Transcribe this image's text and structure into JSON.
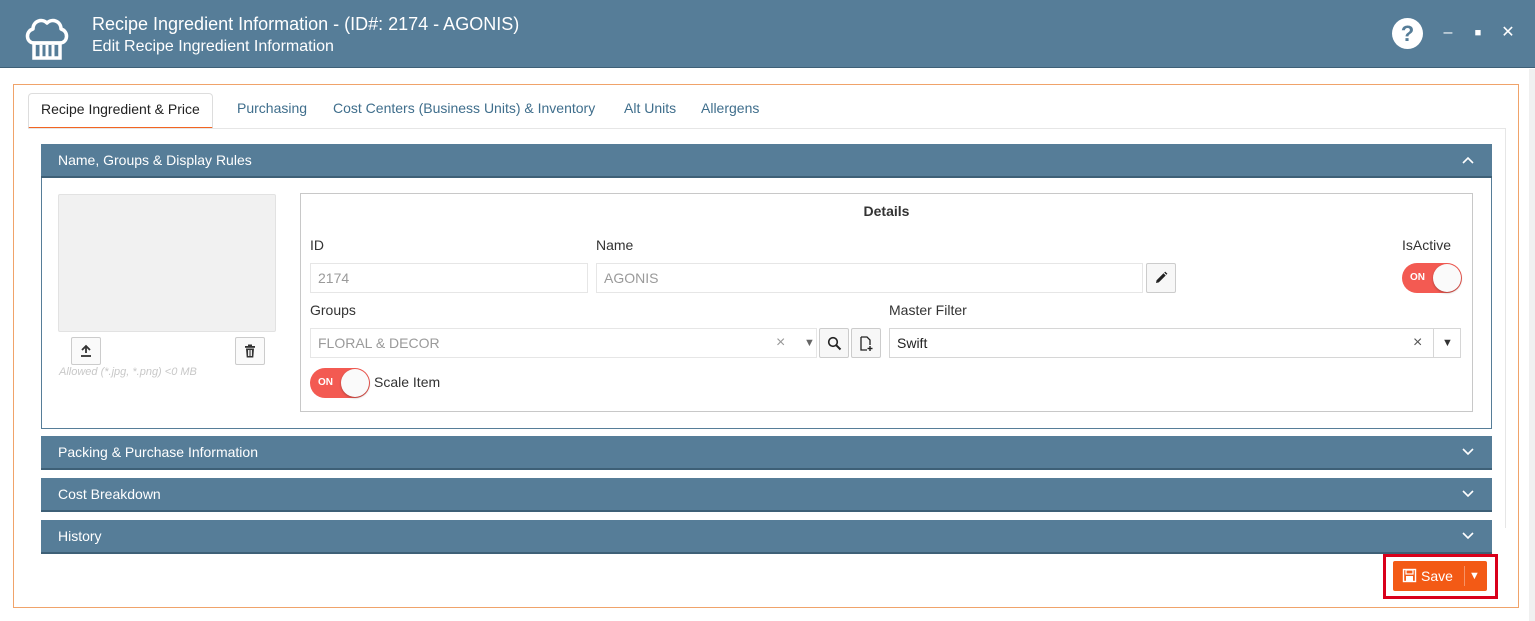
{
  "window": {
    "title": "Recipe Ingredient Information - (ID#: 2174 - AGONIS)",
    "subtitle": "Edit Recipe Ingredient Information",
    "help": "?",
    "minimize": "–",
    "maximize": "■",
    "close": "✕"
  },
  "tabs": [
    {
      "label": "Recipe Ingredient & Price",
      "active": true
    },
    {
      "label": "Purchasing",
      "active": false
    },
    {
      "label": "Cost Centers (Business Units) & Inventory",
      "active": false
    },
    {
      "label": "Alt Units",
      "active": false
    },
    {
      "label": "Allergens",
      "active": false
    }
  ],
  "panels": {
    "name_groups": {
      "title": "Name, Groups & Display Rules",
      "expanded": true
    },
    "packing": {
      "title": "Packing & Purchase Information",
      "expanded": false
    },
    "cost": {
      "title": "Cost Breakdown",
      "expanded": false
    },
    "history": {
      "title": "History",
      "expanded": false
    }
  },
  "image": {
    "allowed_text": "Allowed (*.jpg, *.png) <0 MB"
  },
  "details": {
    "title": "Details",
    "id_label": "ID",
    "id_value": "2174",
    "name_label": "Name",
    "name_value": "AGONIS",
    "isactive_label": "IsActive",
    "isactive_state": "ON",
    "groups_label": "Groups",
    "groups_value": "FLORAL & DECOR",
    "master_filter_label": "Master Filter",
    "master_filter_value": "Swift",
    "scale_item_label": "Scale Item",
    "scale_item_state": "ON"
  },
  "toolbar": {
    "save_label": "Save"
  },
  "colors": {
    "header_blue": "#567d98",
    "accent_orange": "#f35a15",
    "toggle_red": "#f35a52",
    "highlight_red": "#d9001b"
  }
}
